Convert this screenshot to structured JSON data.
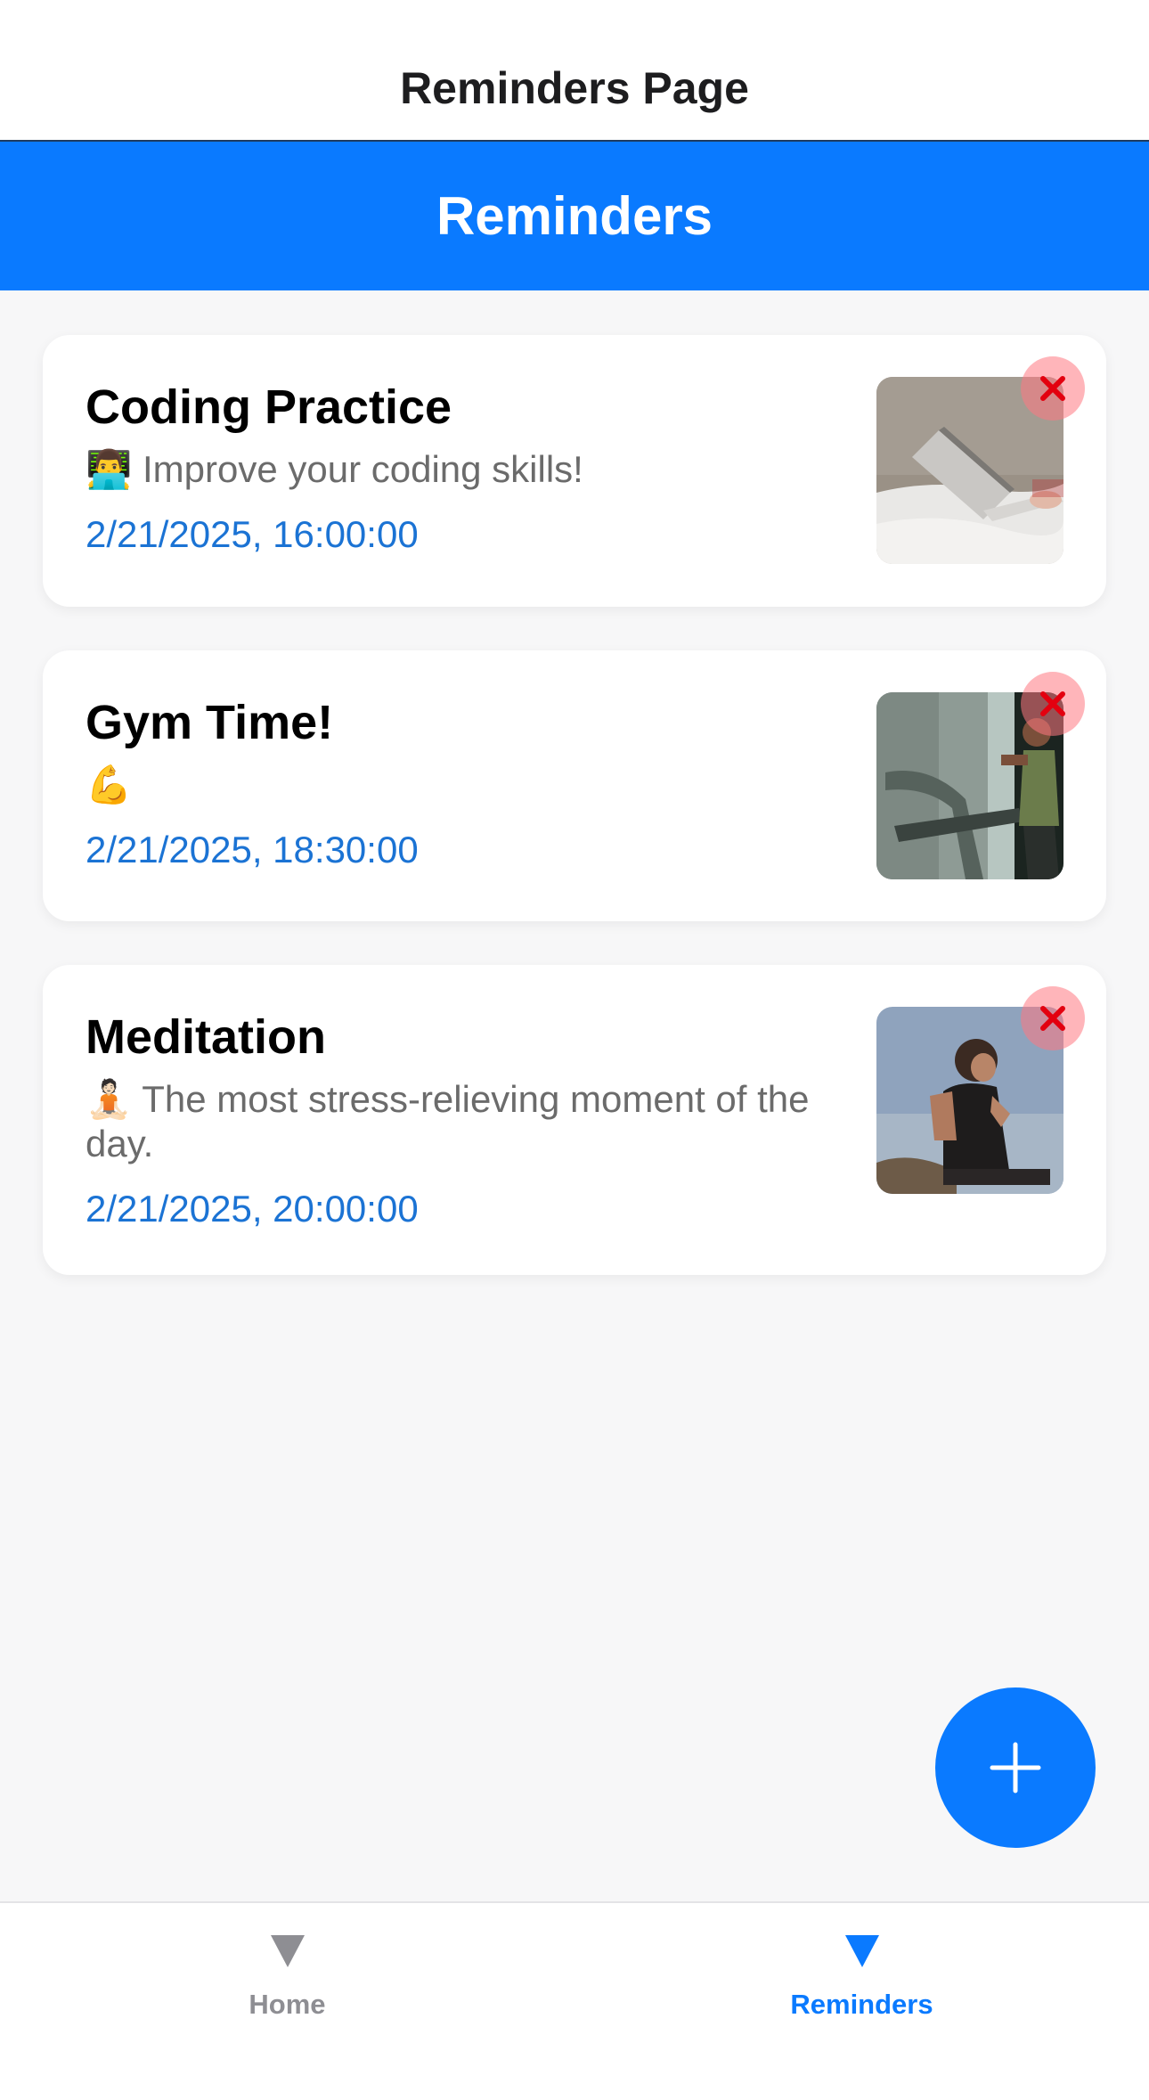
{
  "header": {
    "title": "Reminders Page"
  },
  "banner": {
    "title": "Reminders"
  },
  "reminders": [
    {
      "title": "Coding Practice",
      "emoji": "👨‍💻",
      "description": "Improve your coding skills!",
      "datetime": "2/21/2025, 16:00:00",
      "image": "person-laptop-on-bed-photo"
    },
    {
      "title": "Gym Time!",
      "emoji": "💪",
      "description": "",
      "datetime": "2/21/2025, 18:30:00",
      "image": "man-on-treadmill-photo"
    },
    {
      "title": "Meditation",
      "emoji": "🧘🏻",
      "description": "The most stress-relieving moment of the day.",
      "datetime": "2/21/2025, 20:00:00",
      "image": "man-meditating-photo"
    }
  ],
  "fab": {
    "icon": "plus-icon"
  },
  "tabbar": {
    "items": [
      {
        "label": "Home",
        "icon": "triangle-down-icon",
        "active": false
      },
      {
        "label": "Reminders",
        "icon": "triangle-down-icon",
        "active": true
      }
    ]
  },
  "colors": {
    "accent": "#0a7aff",
    "date_text": "#1b73d4",
    "delete_icon": "#e3000f",
    "inactive_tab": "#8e8e93"
  }
}
